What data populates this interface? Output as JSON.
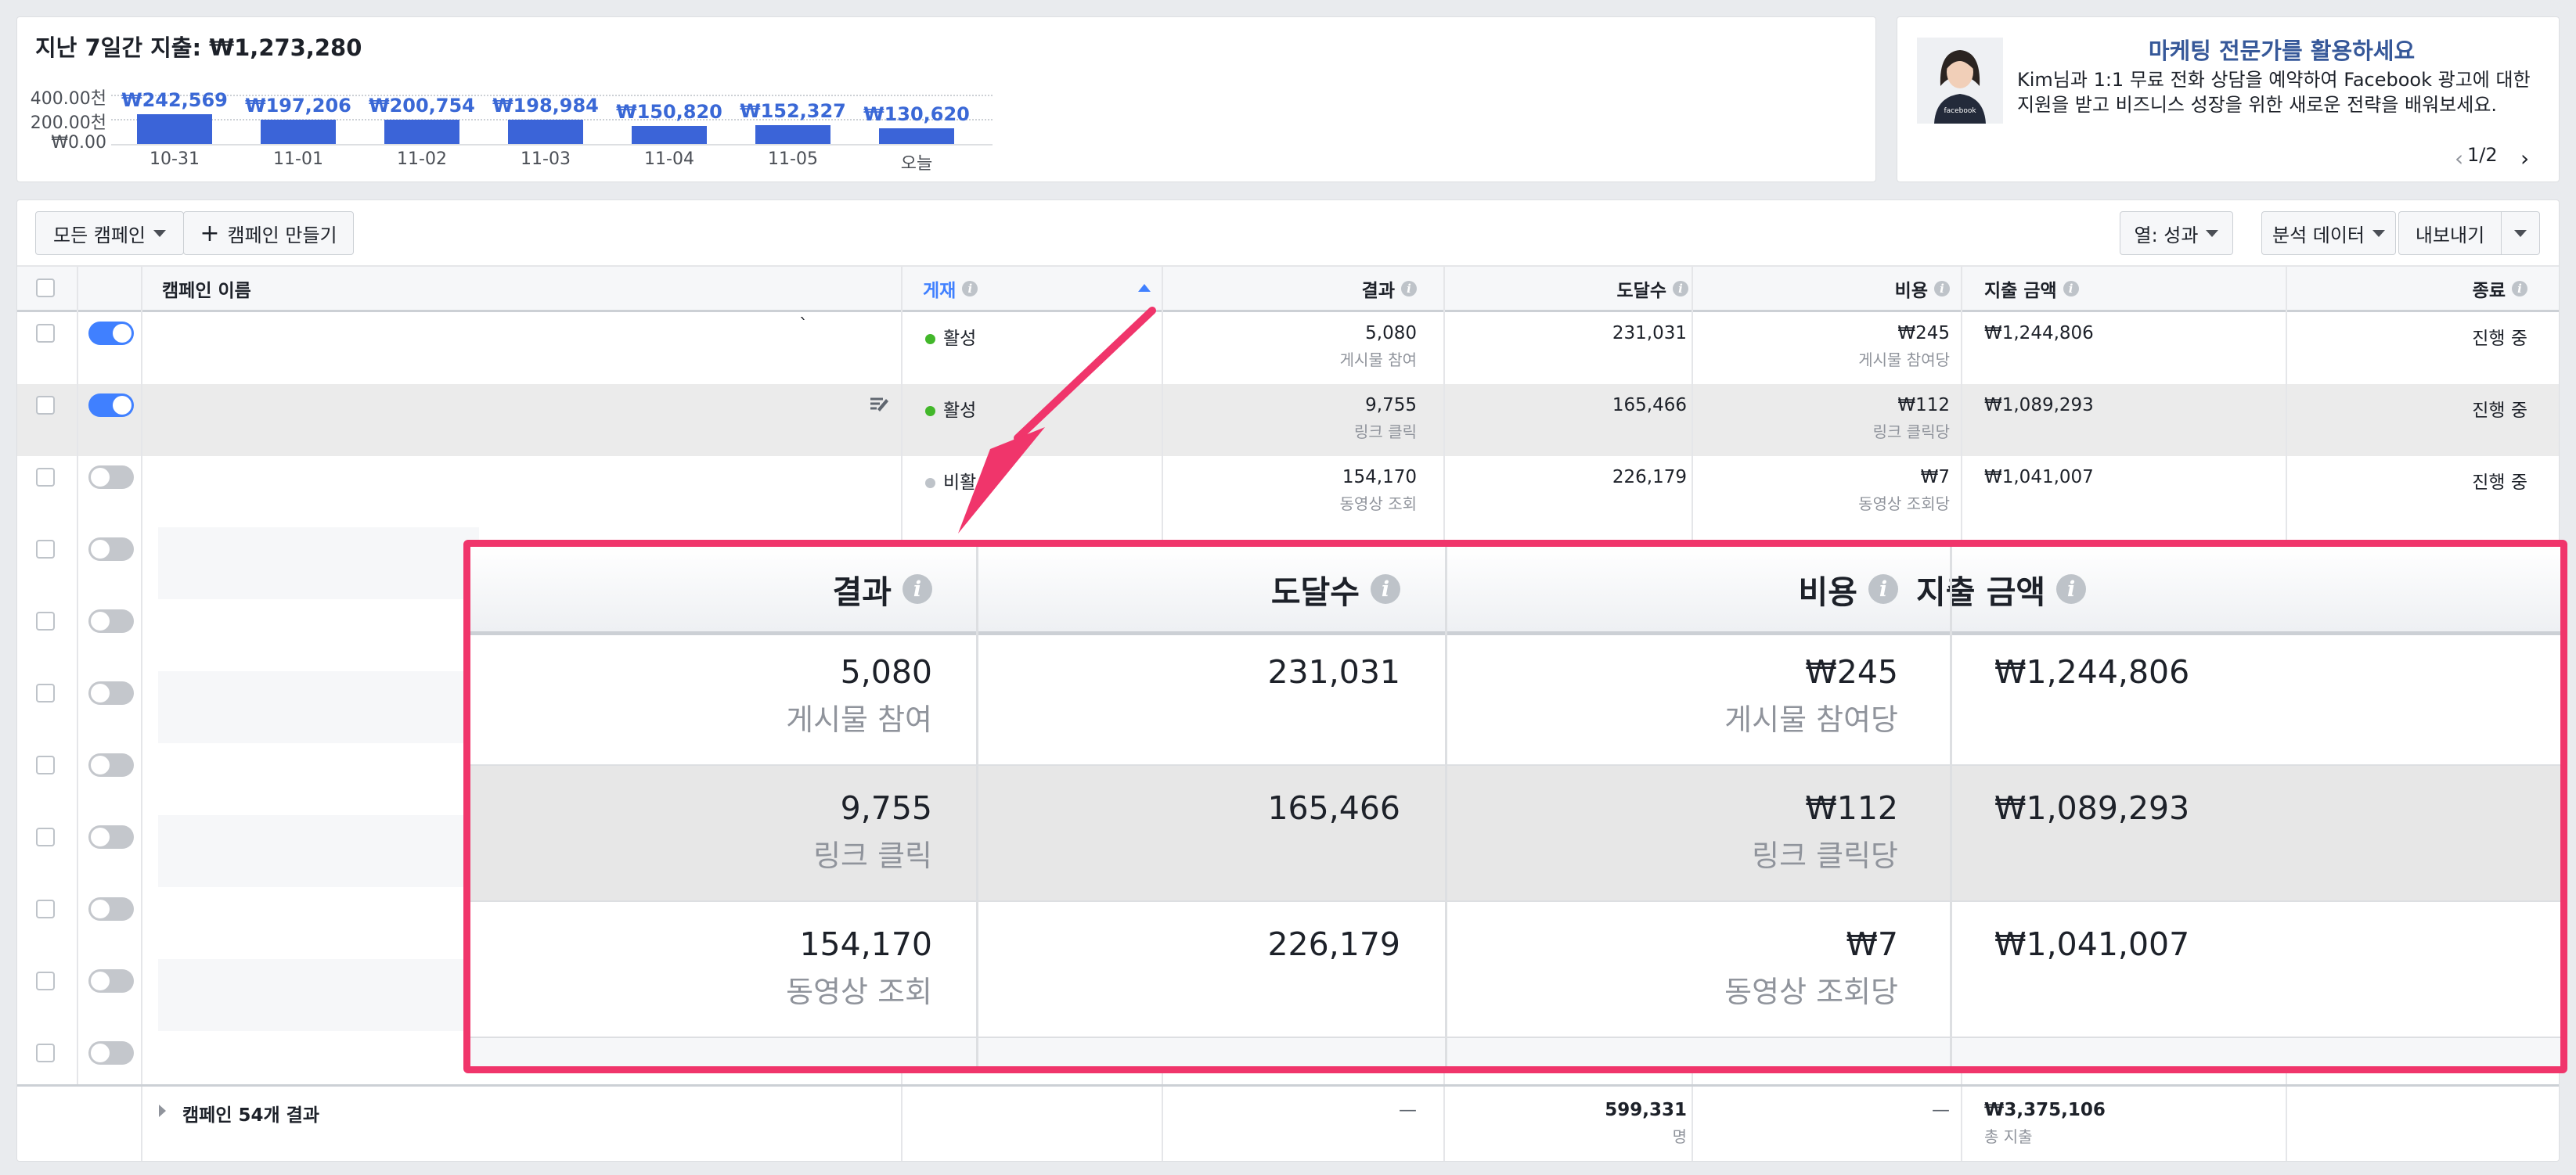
{
  "spend": {
    "title": "지난 7일간 지출: ₩1,273,280",
    "y_ticks": [
      "400.00천",
      "200.00천",
      "₩0.00"
    ],
    "days": [
      {
        "date": "10-31",
        "value": 242569,
        "label": "₩242,569"
      },
      {
        "date": "11-01",
        "value": 197206,
        "label": "₩197,206"
      },
      {
        "date": "11-02",
        "value": 200754,
        "label": "₩200,754"
      },
      {
        "date": "11-03",
        "value": 198984,
        "label": "₩198,984"
      },
      {
        "date": "11-04",
        "value": 150820,
        "label": "₩150,820"
      },
      {
        "date": "11-05",
        "value": 152327,
        "label": "₩152,327"
      },
      {
        "date": "오늘",
        "value": 130620,
        "label": "₩130,620"
      }
    ]
  },
  "promo": {
    "title": "마케팅 전문가를 활용하세요",
    "body": "Kim님과 1:1 무료 전화 상담을 예약하여 Facebook 광고에 대한 지원을 받고 비즈니스 성장을 위한 새로운 전략을 배워보세요.",
    "shirt_text": "facebook",
    "pager": "1/2"
  },
  "toolbar": {
    "all_campaigns": "모든 캠페인",
    "create_campaign": "캠페인 만들기",
    "columns": "열: 성과",
    "breakdown": "분석 데이터",
    "export": "내보내기"
  },
  "table": {
    "headers": {
      "name": "캠페인 이름",
      "delivery": "게재",
      "results": "결과",
      "reach": "도달수",
      "cost": "비용",
      "spent": "지출 금액",
      "ends": "종료"
    },
    "rows": [
      {
        "toggle": "on",
        "status": "활성",
        "status_color": "#42b72a",
        "results": "5,080",
        "results_type": "게시물 참여",
        "reach": "231,031",
        "cost": "₩245",
        "cost_type": "게시물 참여당",
        "spent": "₩1,244,806",
        "ends": "진행 중"
      },
      {
        "toggle": "on",
        "status": "활성",
        "status_color": "#42b72a",
        "results": "9,755",
        "results_type": "링크 클릭",
        "reach": "165,466",
        "cost": "₩112",
        "cost_type": "링크 클릭당",
        "spent": "₩1,089,293",
        "ends": "진행 중"
      },
      {
        "toggle": "off",
        "status": "비활",
        "status_color": "#bec3c9",
        "results": "154,170",
        "results_type": "동영상 조회",
        "reach": "226,179",
        "cost": "₩7",
        "cost_type": "동영상 조회당",
        "spent": "₩1,041,007",
        "ends": "진행 중"
      }
    ],
    "extra_toggle_rows": 7,
    "footer": {
      "label": "캠페인 54개 결과",
      "results": "—",
      "reach": "599,331",
      "reach_unit": "명",
      "cost": "—",
      "spent": "₩3,375,106",
      "spent_unit": "총 지출"
    }
  },
  "colors": {
    "accent": "#4080ff",
    "highlight_border": "#f0356b",
    "bar": "#3b64d8",
    "link": "#365899"
  }
}
